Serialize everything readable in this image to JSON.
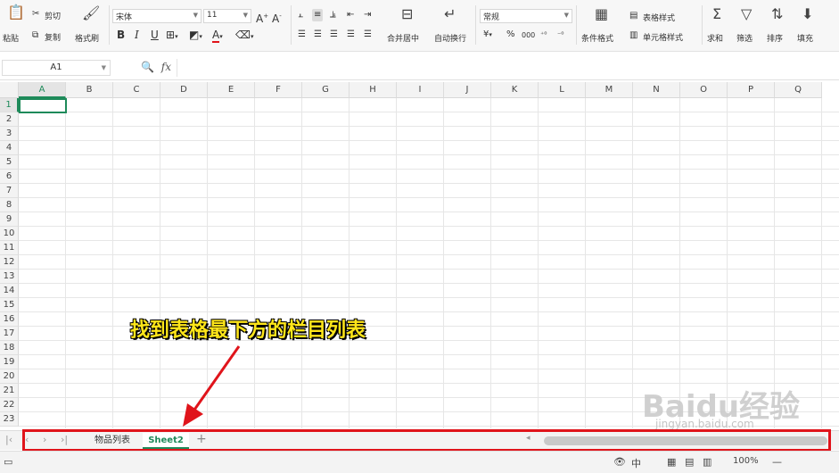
{
  "ribbon": {
    "paste": "粘贴",
    "cut": "剪切",
    "copy": "复制",
    "format_painter": "格式刷",
    "font_name": "宋体",
    "font_size": "11",
    "bold": "B",
    "italic": "I",
    "underline": "U",
    "merge_center": "合并居中",
    "wrap_text": "自动换行",
    "number_format": "常规",
    "percent": "%",
    "thousands": "000",
    "conditional_format": "条件格式",
    "table_style": "表格样式",
    "cell_style": "单元格样式",
    "sum": "求和",
    "filter": "筛选",
    "sort": "排序",
    "fill": "填充"
  },
  "formula_bar": {
    "cell_ref": "A1",
    "fx": "fx"
  },
  "grid": {
    "columns": [
      "A",
      "B",
      "C",
      "D",
      "E",
      "F",
      "G",
      "H",
      "I",
      "J",
      "K",
      "L",
      "M",
      "N",
      "O",
      "P",
      "Q"
    ],
    "rows": [
      "1",
      "2",
      "3",
      "4",
      "5",
      "6",
      "7",
      "8",
      "9",
      "10",
      "11",
      "12",
      "13",
      "14",
      "15",
      "16",
      "17",
      "18",
      "19",
      "20",
      "21",
      "22",
      "23"
    ],
    "active_column": "A",
    "active_row": "1"
  },
  "sheets": {
    "tabs": [
      {
        "label": "物品列表",
        "active": false
      },
      {
        "label": "Sheet2",
        "active": true
      }
    ],
    "add": "+"
  },
  "status": {
    "zoom": "100%",
    "zoom_minus": "—"
  },
  "annotation": {
    "text": "找到表格最下方的栏目列表",
    "color": "#ffe61a",
    "box_color": "#e0141b"
  },
  "watermark": {
    "brand": "Baidu经验",
    "url": "jingyan.baidu.com"
  },
  "colors": {
    "accent": "#1e8a5a"
  }
}
